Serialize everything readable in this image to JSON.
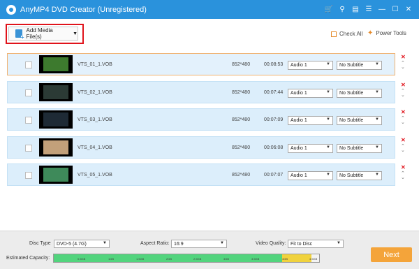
{
  "app": {
    "title": "AnyMP4 DVD Creator (Unregistered)",
    "accent": "#2a92dc"
  },
  "window_controls": [
    "cart-icon",
    "key-icon",
    "feedback-icon",
    "menu-icon",
    "minimize-icon",
    "maximize-icon",
    "close-icon"
  ],
  "toolbar": {
    "add_media_label": "Add Media File(s)",
    "check_all_label": "Check All",
    "power_tools_label": "Power Tools"
  },
  "files": [
    {
      "name": "VTS_01_1.VOB",
      "resolution": "852*480",
      "duration": "00:08:53",
      "audio": "Audio 1",
      "subtitle": "No Subtitle",
      "thumb_color": "#3d7a2e"
    },
    {
      "name": "VTS_02_1.VOB",
      "resolution": "852*480",
      "duration": "00:07:44",
      "audio": "Audio 1",
      "subtitle": "No Subtitle",
      "thumb_color": "#2b3a35"
    },
    {
      "name": "VTS_03_1.VOB",
      "resolution": "852*480",
      "duration": "00:07:09",
      "audio": "Audio 1",
      "subtitle": "No Subtitle",
      "thumb_color": "#1e2a35"
    },
    {
      "name": "VTS_04_1.VOB",
      "resolution": "852*480",
      "duration": "00:06:08",
      "audio": "Audio 1",
      "subtitle": "No Subtitle",
      "thumb_color": "#c2a07a"
    },
    {
      "name": "VTS_05_1.VOB",
      "resolution": "852*480",
      "duration": "00:07:07",
      "audio": "Audio 1",
      "subtitle": "No Subtitle",
      "thumb_color": "#3e8a5a"
    }
  ],
  "bottom": {
    "disc_type_label": "Disc Type",
    "disc_type_value": "DVD-5 (4.7G)",
    "aspect_ratio_label": "Aspect Ratio:",
    "aspect_ratio_value": "16:9",
    "video_quality_label": "Video Quality:",
    "video_quality_value": "Fit to Disc",
    "capacity_label": "Estimated Capacity:",
    "capacity_ticks": [
      "0.5GB",
      "1GB",
      "1.5GB",
      "2GB",
      "2.5GB",
      "3GB",
      "3.5GB",
      "4GB",
      "4.5GB"
    ],
    "capacity_used_fraction": 0.86,
    "capacity_dvd_fraction": 0.97,
    "next_label": "Next"
  }
}
